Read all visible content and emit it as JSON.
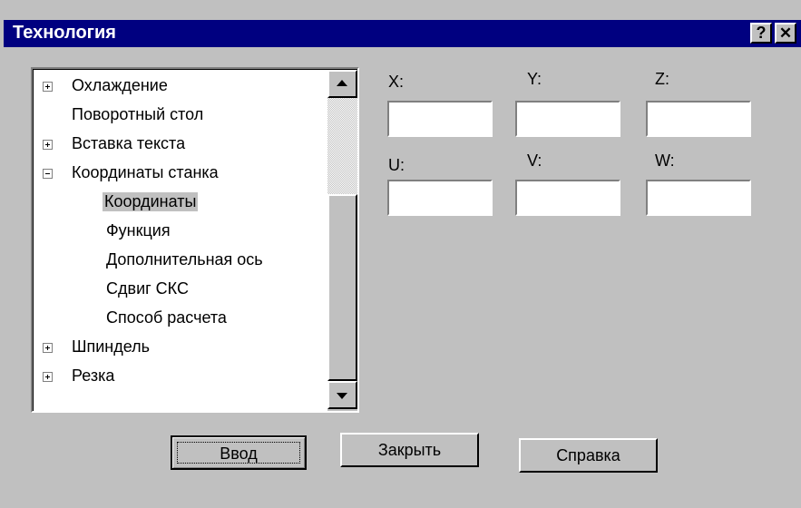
{
  "window": {
    "title": "Технология",
    "help_label": "?",
    "close_label": "✕"
  },
  "tree": {
    "items": [
      {
        "label": "Охлаждение",
        "expander": "plus"
      },
      {
        "label": "Поворотный стол",
        "expander": "none"
      },
      {
        "label": "Вставка текста",
        "expander": "plus"
      },
      {
        "label": "Координаты станка",
        "expander": "minus"
      },
      {
        "label": "Координаты",
        "expander": "child",
        "selected": true
      },
      {
        "label": "Функция",
        "expander": "child"
      },
      {
        "label": "Дополнительная ось",
        "expander": "child"
      },
      {
        "label": "Сдвиг СКС",
        "expander": "child"
      },
      {
        "label": "Способ расчета",
        "expander": "child"
      },
      {
        "label": "Шпиндель",
        "expander": "plus"
      },
      {
        "label": "Резка",
        "expander": "plus"
      }
    ],
    "scroll_up_icon": "arrow-up-icon",
    "scroll_down_icon": "arrow-down-icon"
  },
  "coords": {
    "x": {
      "label": "X:",
      "value": ""
    },
    "y": {
      "label": "Y:",
      "value": ""
    },
    "z": {
      "label": "Z:",
      "value": ""
    },
    "u": {
      "label": "U:",
      "value": ""
    },
    "v": {
      "label": "V:",
      "value": ""
    },
    "w": {
      "label": "W:",
      "value": ""
    }
  },
  "buttons": {
    "enter": "Ввод",
    "close": "Закрыть",
    "help": "Справка"
  },
  "colors": {
    "titlebar": "#000080",
    "face": "#c0c0c0"
  }
}
